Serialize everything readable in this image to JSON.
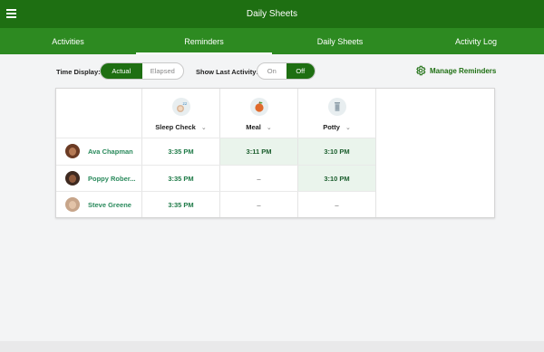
{
  "app": {
    "title": "Daily Sheets"
  },
  "tabs": [
    {
      "label": "Activities"
    },
    {
      "label": "Reminders"
    },
    {
      "label": "Daily Sheets"
    },
    {
      "label": "Activity Log"
    }
  ],
  "active_tab": "Reminders",
  "controls": {
    "time_display_label": "Time Display:",
    "time_display_options": [
      "Actual",
      "Elapsed"
    ],
    "time_display_selected": "Actual",
    "show_last_label": "Show Last Activity:",
    "show_last_options": [
      "On",
      "Off"
    ],
    "show_last_selected": "Off",
    "manage_label": "Manage Reminders"
  },
  "table": {
    "columns": [
      {
        "label": "Sleep Check",
        "icon": "sleep-icon"
      },
      {
        "label": "Meal",
        "icon": "apple-icon"
      },
      {
        "label": "Potty",
        "icon": "trash-can-icon"
      }
    ],
    "rows": [
      {
        "name": "Ava Chapman",
        "cells": [
          "3:35 PM",
          "3:11 PM",
          "3:10 PM"
        ]
      },
      {
        "name": "Poppy Rober...",
        "cells": [
          "3:35 PM",
          "–",
          "3:10 PM"
        ]
      },
      {
        "name": "Steve Greene",
        "cells": [
          "3:35 PM",
          "–",
          "–"
        ]
      }
    ]
  },
  "colors": {
    "appbar": "#1e6f12",
    "tabs": "#2d8a21",
    "accent_text": "#2a8a5c",
    "highlight": "#eaf4ec"
  }
}
